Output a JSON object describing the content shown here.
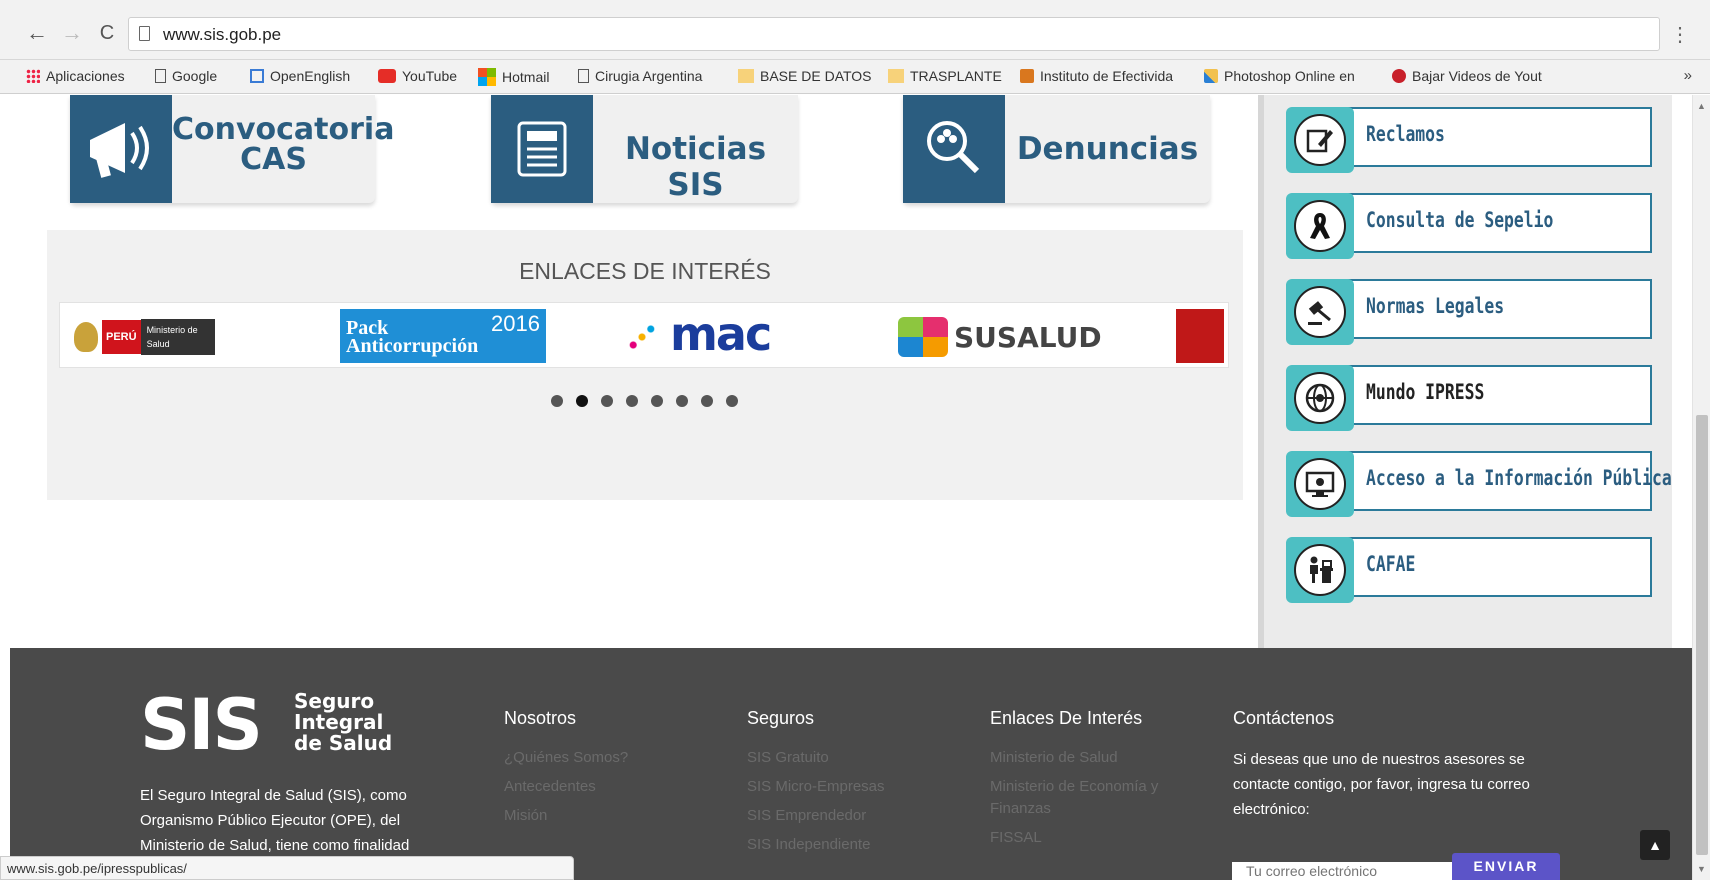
{
  "browser": {
    "url": "www.sis.gob.pe",
    "bookmarks": [
      {
        "label": "Aplicaciones",
        "icon": "apps-grid-icon"
      },
      {
        "label": "Google",
        "icon": "page-icon"
      },
      {
        "label": "OpenEnglish",
        "icon": "page-icon"
      },
      {
        "label": "YouTube",
        "icon": "youtube-icon"
      },
      {
        "label": "Hotmail",
        "icon": "windows-icon"
      },
      {
        "label": "Cirugia Argentina",
        "icon": "page-icon"
      },
      {
        "label": "BASE DE DATOS",
        "icon": "folder-icon"
      },
      {
        "label": "TRASPLANTE",
        "icon": "folder-icon"
      },
      {
        "label": "Instituto de Efectivida",
        "icon": "site-icon"
      },
      {
        "label": "Photoshop Online en",
        "icon": "brush-icon"
      },
      {
        "label": "Bajar Videos de Yout",
        "icon": "site-icon"
      }
    ],
    "more": "»",
    "status_url": "www.sis.gob.pe/ipresspublicas/"
  },
  "quick_links": [
    {
      "line1": "Convocatoria",
      "line2": "CAS",
      "icon": "megaphone-icon"
    },
    {
      "line1": "Noticias SIS",
      "line2": "",
      "icon": "newspaper-icon"
    },
    {
      "line1": "Denuncias",
      "line2": "",
      "icon": "search-people-icon"
    }
  ],
  "enlaces": {
    "title": "ENLACES DE INTERÉS",
    "logos": [
      {
        "name": "peru-minsa-logo",
        "text": "PERÚ",
        "text2": "Ministerio de Salud"
      },
      {
        "name": "pack-anticorrupcion-logo",
        "text": "Pack Anticorrupción",
        "year": "2016"
      },
      {
        "name": "mac-logo",
        "text": "mac"
      },
      {
        "name": "susalud-logo",
        "text": "SUSALUD"
      }
    ],
    "carousel_active_index": 1,
    "carousel_count": 8
  },
  "sidebar": {
    "items": [
      {
        "label": "Reclamos",
        "icon": "edit-icon",
        "dark": false
      },
      {
        "label": "Consulta de Sepelio",
        "icon": "ribbon-icon",
        "dark": false
      },
      {
        "label": "Normas Legales",
        "icon": "gavel-icon",
        "dark": false
      },
      {
        "label": "Mundo IPRESS",
        "icon": "globe-icon",
        "dark": true
      },
      {
        "label": "Acceso a la Información Pública",
        "icon": "monitor-gear-icon",
        "dark": false
      },
      {
        "label": "CAFAE",
        "icon": "desk-person-icon",
        "dark": false
      }
    ]
  },
  "footer": {
    "logo": "SIS",
    "logo_sub": [
      "Seguro",
      "Integral",
      "de Salud"
    ],
    "description": "El Seguro Integral de Salud (SIS), como Organismo Público Ejecutor (OPE), del Ministerio de Salud, tiene como finalidad",
    "columns": [
      {
        "title": "Nosotros",
        "links": [
          "¿Quiénes Somos?",
          "Antecedentes",
          "Misión"
        ]
      },
      {
        "title": "Seguros",
        "links": [
          "SIS Gratuito",
          "SIS Micro-Empresas",
          "SIS Emprendedor",
          "SIS Independiente"
        ]
      },
      {
        "title": "Enlaces De Interés",
        "links": [
          "Ministerio de Salud",
          "Ministerio de Economía y Finanzas",
          "FISSAL"
        ]
      }
    ],
    "contact": {
      "title": "Contáctenos",
      "text": "Si deseas que uno de nuestros asesores se contacte contigo, por favor, ingresa tu correo electrónico:",
      "placeholder": "Tu correo electrónico",
      "button": "ENVIAR"
    }
  },
  "colors": {
    "brand_blue": "#2b5d80",
    "teal": "#4dbfc3",
    "footer": "#4a4a4a",
    "send_button": "#5c54c8"
  }
}
